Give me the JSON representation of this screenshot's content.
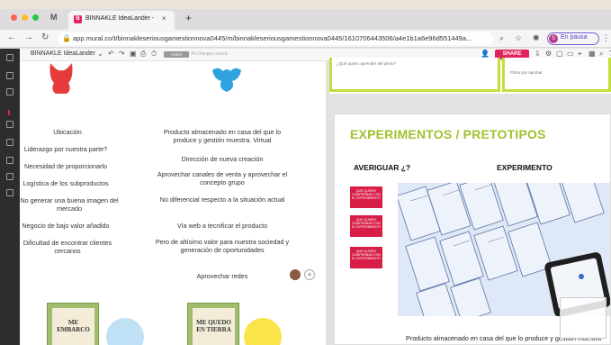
{
  "browser": {
    "tab_inactive_label": "M",
    "tab_active_title": "BINNAKLE IdeaLander - BINN",
    "tab_fav": "B",
    "tab_close": "×",
    "new_tab": "+",
    "url": "app.mural.co/t/binnakleseriousgamestionnova0445/m/binnakleseriousgamestionnova0445/1610706443506/a4e1b1a6e96d551449a...",
    "profile_initial": "S",
    "profile_label": "En pausa"
  },
  "mural": {
    "title": "BINNAKLE IdeaLander",
    "badge": "TIMER",
    "saved": "All changes saved",
    "share": "SHARE",
    "green_box_prompt": "¿Qué quiero aprender del piloto?",
    "green_box2_prompt": "Piloto por aprobar"
  },
  "board_left": {
    "col1": [
      "Ubicación",
      "Liderazgo por nuestra parte?",
      "Necesidad de proporcionarlo",
      "Logística de los subproductos",
      "No generar una buena imagen del mercado",
      "Negocio de bajo valor añadido",
      "Dificultad de encontrar clientes cercanos"
    ],
    "col2": [
      "Producto almacenado en casa del que lo produce y gestión muestra. Virtual",
      "Dirección de nueva creación",
      "Aprovechar canales de venta y aprovechar el concepto grupo",
      "No diferencial respecto a la situación actual",
      "Vía web a tecnificar el producto",
      "Pero de altísimo valor para nuestra sociedad y generación de oportunidades",
      "Aprovechar redes"
    ],
    "book1": "ME EMBARCO",
    "book2": "ME QUEDO EN TIERRA"
  },
  "board_right": {
    "title": "EXPERIMENTOS / PRETOTIPOS",
    "col_a": "AVERIGUAR ¿?",
    "col_b": "EXPERIMENTO",
    "sticky": "QUE QUIERO COMPROBAR CON EL EXPERIMENTO?",
    "bottom": "Producto almacenado en casa del que lo produce y gestión muestra"
  },
  "colors": {
    "accent": "#e0245e",
    "lime": "#c6de3a",
    "title_green": "#9ec32e"
  }
}
